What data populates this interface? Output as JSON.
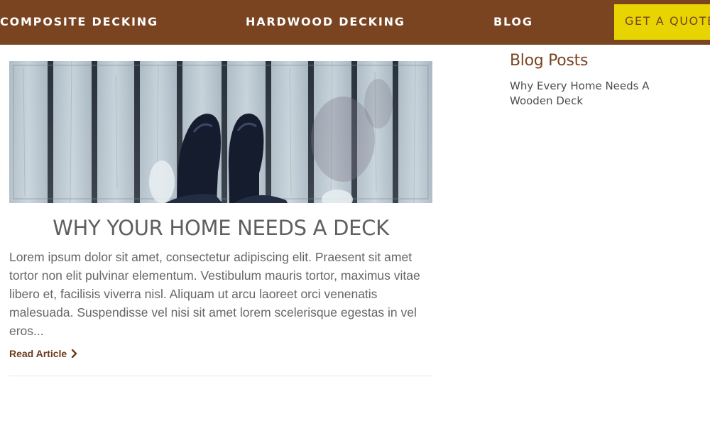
{
  "nav": {
    "items": [
      {
        "label": "COMPOSITE DECKING"
      },
      {
        "label": "HARDWOOD DECKING"
      },
      {
        "label": "BLOG"
      }
    ],
    "cta_label": "GET A QUOTE"
  },
  "post": {
    "title": "WHY YOUR HOME NEEDS A DECK",
    "excerpt": "Lorem ipsum dolor sit amet, consectetur adipiscing elit. Praesent sit amet tortor non elit pulvinar elementum. Vestibulum mauris tortor, maximus vitae libero et, facilisis viverra nisl. Aliquam ut arcu laoreet orci venenatis malesuada. Suspendisse vel nisi sit amet lorem scelerisque egestas in vel eros...",
    "read_more": "Read Article",
    "image_icon": "deck-boards-with-shoes-photo"
  },
  "sidebar": {
    "title": "Blog Posts",
    "links": [
      {
        "label": "Why Every Home Needs A Wooden Deck"
      }
    ]
  },
  "colors": {
    "brand_brown": "#7a4421",
    "accent_yellow": "#e8d400",
    "body_text": "#666666",
    "title_text": "#5f5f5f"
  }
}
